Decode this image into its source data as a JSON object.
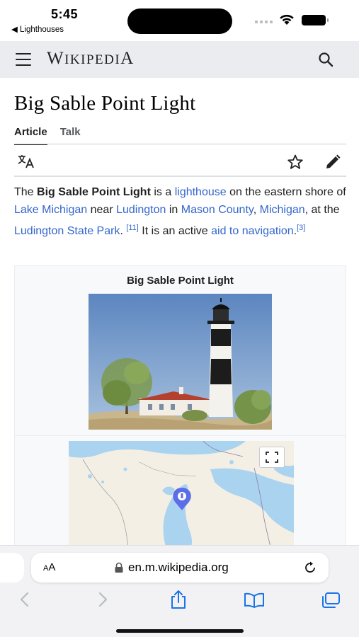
{
  "status_bar": {
    "time": "5:45",
    "back_app": "◀ Lighthouses"
  },
  "header": {
    "wordmark_big": "W",
    "wordmark_rest": "IKIPEDI",
    "wordmark_end": "A"
  },
  "page": {
    "title": "Big Sable Point Light"
  },
  "tabs": [
    {
      "label": "Article",
      "active": true
    },
    {
      "label": "Talk",
      "active": false
    }
  ],
  "lead": {
    "t1": "The ",
    "bold": "Big Sable Point Light",
    "t2": " is a ",
    "link_lighthouse": "lighthouse",
    "t3": " on the eastern shore of ",
    "link_lake": "Lake Michigan",
    "t4": " near ",
    "link_ludington": "Ludington",
    "t5": " in ",
    "link_county": "Mason County",
    "t6": ", ",
    "link_michigan": "Michigan",
    "t7": ", at the ",
    "link_park": "Ludington State Park",
    "t8": ". ",
    "ref1": "[11]",
    "t9": " It is an active ",
    "link_nav": "aid to navigation",
    "t10": ".",
    "ref2": "[3]"
  },
  "infobox": {
    "caption": "Big Sable Point Light"
  },
  "safari": {
    "aa_small": "A",
    "aa_big": "A",
    "url": "en.m.wikipedia.org"
  },
  "colors": {
    "link": "#3366cc",
    "header_bg": "#eaecf0",
    "toolbar_blue": "#1a73e8"
  },
  "icons": [
    "menu-icon",
    "search-icon",
    "translate-icon",
    "star-icon",
    "edit-icon",
    "fullscreen-icon",
    "lock-icon",
    "reload-icon",
    "back-icon",
    "forward-icon",
    "share-icon",
    "bookmarks-icon",
    "tabs-icon"
  ]
}
